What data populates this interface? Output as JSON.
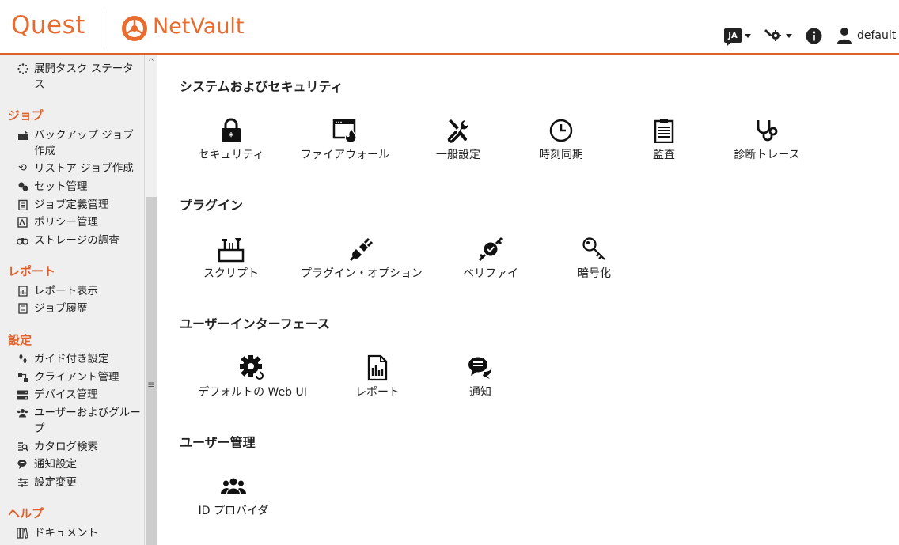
{
  "header": {
    "brand": "Quest",
    "product": "NetVault",
    "language": "JA",
    "user": "default"
  },
  "sidebar": {
    "items_top": [
      {
        "label": "展開タスク ステータス",
        "icon": "spinner-icon"
      }
    ],
    "sections": [
      {
        "title": "ジョブ",
        "items": [
          {
            "label": "バックアップ ジョブ作成",
            "icon": "backup-icon"
          },
          {
            "label": "リストア ジョブ作成",
            "icon": "restore-icon"
          },
          {
            "label": "セット管理",
            "icon": "sets-icon"
          },
          {
            "label": "ジョブ定義管理",
            "icon": "clipboard-icon"
          },
          {
            "label": "ポリシー管理",
            "icon": "policy-icon"
          },
          {
            "label": "ストレージの調査",
            "icon": "binoculars-icon"
          }
        ]
      },
      {
        "title": "レポート",
        "items": [
          {
            "label": "レポート表示",
            "icon": "report-icon"
          },
          {
            "label": "ジョブ履歴",
            "icon": "history-icon"
          }
        ]
      },
      {
        "title": "設定",
        "items": [
          {
            "label": "ガイド付き設定",
            "icon": "footsteps-icon"
          },
          {
            "label": "クライアント管理",
            "icon": "clients-icon"
          },
          {
            "label": "デバイス管理",
            "icon": "devices-icon"
          },
          {
            "label": "ユーザーおよびグループ",
            "icon": "users-icon"
          },
          {
            "label": "カタログ検索",
            "icon": "catalog-search-icon"
          },
          {
            "label": "通知設定",
            "icon": "notification-icon"
          },
          {
            "label": "設定変更",
            "icon": "sliders-icon"
          }
        ]
      },
      {
        "title": "ヘルプ",
        "items": [
          {
            "label": "ドキュメント",
            "icon": "books-icon"
          }
        ]
      }
    ]
  },
  "main": {
    "sections": [
      {
        "title": "システムおよびセキュリティ",
        "tiles": [
          {
            "label": "セキュリティ",
            "icon": "lock-icon"
          },
          {
            "label": "ファイアウォール",
            "icon": "firewall-icon"
          },
          {
            "label": "一般設定",
            "icon": "tools-icon"
          },
          {
            "label": "時刻同期",
            "icon": "clock-icon"
          },
          {
            "label": "監査",
            "icon": "audit-clipboard-icon"
          },
          {
            "label": "診断トレース",
            "icon": "stethoscope-icon"
          }
        ]
      },
      {
        "title": "プラグイン",
        "tiles": [
          {
            "label": "スクリプト",
            "icon": "toolbox-icon"
          },
          {
            "label": "プラグイン・オプション",
            "icon": "plug-icon"
          },
          {
            "label": "ベリファイ",
            "icon": "verify-icon"
          },
          {
            "label": "暗号化",
            "icon": "key-icon"
          }
        ]
      },
      {
        "title": "ユーザーインターフェース",
        "tiles": [
          {
            "label": "デフォルトの Web UI",
            "icon": "gear-refresh-icon"
          },
          {
            "label": "レポート",
            "icon": "report-doc-icon"
          },
          {
            "label": "通知",
            "icon": "chat-icon"
          }
        ]
      },
      {
        "title": "ユーザー管理",
        "tiles": [
          {
            "label": "ID プロバイダ",
            "icon": "users-group-icon"
          }
        ]
      }
    ]
  }
}
